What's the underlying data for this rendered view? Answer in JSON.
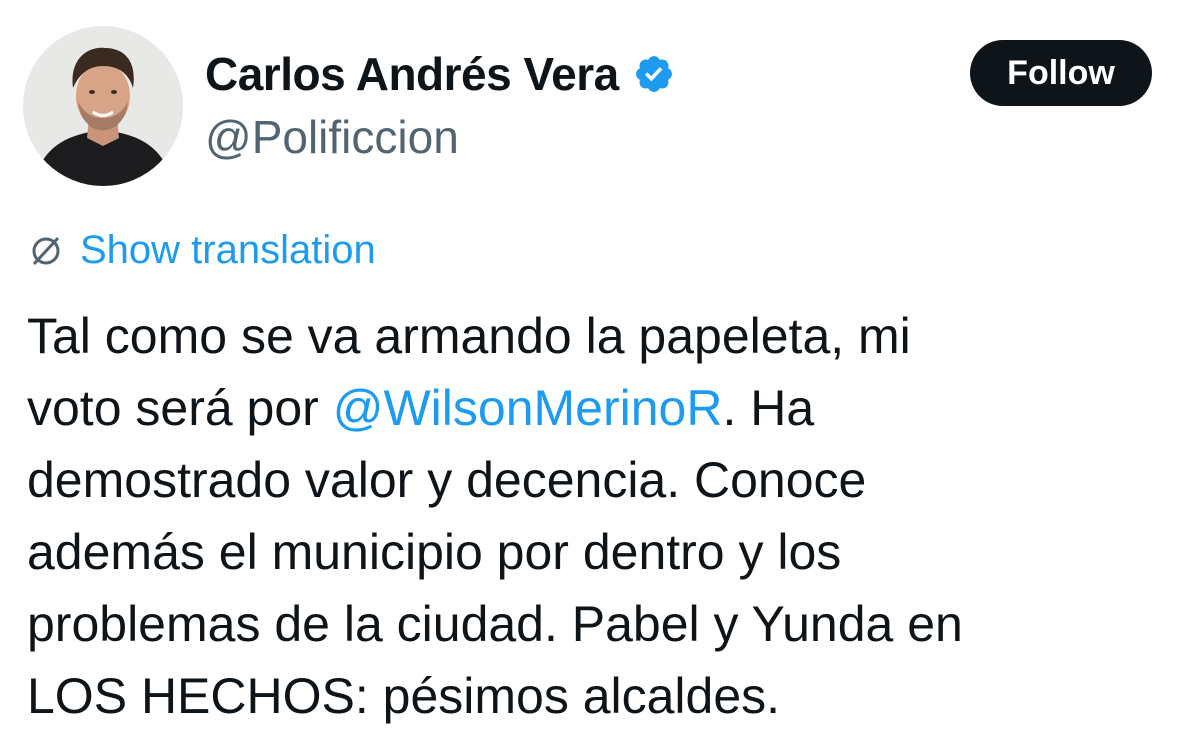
{
  "author": {
    "display_name": "Carlos Andrés Vera",
    "handle": "@Polificcion",
    "verified_icon": "verified-badge-icon",
    "verified_color": "#1d9bf0"
  },
  "actions": {
    "follow_label": "Follow"
  },
  "translation": {
    "icon": "translate-globe-icon",
    "label": "Show translation",
    "color": "#1d9bf0"
  },
  "tweet": {
    "line1": "Tal como se va armando la papeleta, mi",
    "line2_before": "voto será por ",
    "mention": "@WilsonMerinoR",
    "line2_after": ". Ha",
    "line3": "demostrado valor y decencia. Conoce",
    "line4": "además el municipio por dentro y los",
    "line5": "problemas de la ciudad. Pabel y Yunda en",
    "line6": "LOS HECHOS: pésimos alcaldes."
  },
  "colors": {
    "text": "#0f1419",
    "secondary_text": "#536471",
    "link": "#1d9bf0",
    "button_bg": "#0f1419",
    "button_text": "#ffffff"
  }
}
